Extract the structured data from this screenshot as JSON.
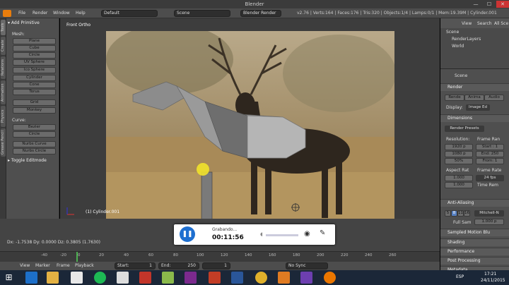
{
  "window": {
    "title": "Blender",
    "minimize": "—",
    "maximize": "☐",
    "close": "✕"
  },
  "header": {
    "menus": [
      "File",
      "Render",
      "Window",
      "Help"
    ],
    "layout": "Default",
    "scene": "Scene",
    "engine": "Blender Render",
    "stats": "v2.76 | Verts:164 | Faces:176 | Tris:320 | Objects:1/4 | Lamps:0/1 | Mem:19.39M | Cylinder.001"
  },
  "left_tabs": [
    "Tools",
    "Create",
    "Relations",
    "Animation",
    "Physics",
    "Grease Pencil"
  ],
  "tool_shelf": {
    "add_primitive": "Add Primitive",
    "mesh_label": "Mesh:",
    "mesh_items": [
      "Plane",
      "Cube",
      "Circle",
      "UV Sphere",
      "Ico Sphere",
      "Cylinder",
      "Cone",
      "Torus"
    ],
    "other_items": [
      "Grid",
      "Monkey"
    ],
    "curve_label": "Curve:",
    "curve_items": [
      "Bezier",
      "Circle",
      "Nurbs Curve",
      "Nurbs Circle"
    ],
    "toggle_editmode": "Toggle Editmode"
  },
  "viewport": {
    "view_name": "Front Ortho",
    "object_label": "(1) Cylinder.001"
  },
  "outliner": {
    "view": "View",
    "search": "Search",
    "all_scenes": "All Sce",
    "items": [
      "Scene",
      "RenderLayers",
      "World"
    ]
  },
  "properties": {
    "scene": "Scene",
    "render_header": "Render",
    "render_buttons": [
      "Rende",
      "Anima",
      "Audio"
    ],
    "display_label": "Display:",
    "display_value": "Image Ed",
    "dimensions": "Dimensions",
    "render_presets": "Render Presets",
    "resolution": "Resolution:",
    "frame_range": "Frame Ran",
    "res_x": "1920 p",
    "res_y": "1080 p",
    "res_pct": "50%",
    "start": "Start : 1",
    "end": "End: 250",
    "step": "From: 1",
    "aspect": "Aspect Rat",
    "frame_rate": "Frame Rate",
    "aspect_x": "1.000",
    "aspect_y": "1.000",
    "fps": "24 fps",
    "time_rem": "Time Rem",
    "anti_aliasing": "Anti-Aliasing",
    "aa_values": [
      "5",
      "8",
      "11",
      "16"
    ],
    "aa_filter": "Mitchell-N",
    "full_sample": "Full Sam",
    "full_sample_px": "1.000 p",
    "sampled_motion_blur": "Sampled Motion Blu",
    "shading": "Shading",
    "performance": "Performance",
    "post_processing": "Post Processing",
    "metadata": "Metadata"
  },
  "status": {
    "text": "Dx: -1.7538  Dy: 0.0000  Dz: 0.3805 (1.7630)"
  },
  "timeline": {
    "ticks": [
      "-40",
      "-20",
      "0",
      "20",
      "40",
      "60",
      "80",
      "100",
      "120",
      "140",
      "160",
      "180",
      "200",
      "220",
      "240",
      "260"
    ],
    "menus": [
      "View",
      "Marker",
      "Frame",
      "Playback"
    ],
    "start": "Start:",
    "start_val": "1",
    "end": "End:",
    "end_val": "250",
    "current": "1",
    "sync": "No Sync"
  },
  "recorder": {
    "label": "Grabando...",
    "time": "00:11:56"
  },
  "taskbar": {
    "lang": "ESP",
    "time": "17:21",
    "date": "24/11/2015"
  }
}
